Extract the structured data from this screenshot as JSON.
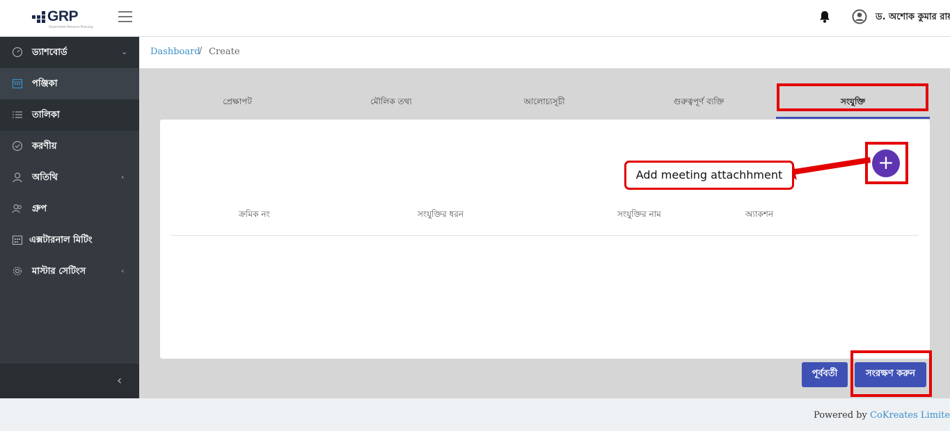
{
  "header": {
    "logo_text": "GRP",
    "logo_tagline": "Government Resource Planning",
    "username": "ড. অশোক কুমার রায়"
  },
  "sidebar": {
    "items": [
      {
        "label": "ড্যাশবোর্ড",
        "icon": "dashboard-gauge-icon",
        "chevron": "⌄"
      },
      {
        "label": "পঞ্জিকা",
        "icon": "calendar-icon"
      },
      {
        "label": "তালিকা",
        "icon": "list-icon"
      },
      {
        "label": "করণীয়",
        "icon": "check-circle-icon"
      },
      {
        "label": "অতিথি",
        "icon": "user-icon",
        "chevron": "‹"
      },
      {
        "label": "গ্রুপ",
        "icon": "group-icon"
      },
      {
        "label": "এক্সটারনাল মিটিং",
        "icon": "calendar-grid-icon"
      },
      {
        "label": "মাস্টার সেটিংস",
        "icon": "gear-icon",
        "chevron": "‹"
      }
    ],
    "collapse_glyph": "‹"
  },
  "breadcrumb": {
    "root": "Dashboard",
    "separator": "/",
    "current": "Create"
  },
  "tabs": [
    {
      "label": "প্রেক্ষাপট"
    },
    {
      "label": "মৌলিক তথ্য"
    },
    {
      "label": "আলোচ্যসূচী"
    },
    {
      "label": "গুরুত্বপূর্ণ ব্যক্তি"
    },
    {
      "label": "সংযুক্তি",
      "active": true
    }
  ],
  "table": {
    "headers": [
      "ক্রমিক নং",
      "সংযুক্তির ধরন",
      "সংযুক্তির নাম",
      "অ্যাকশন"
    ],
    "rows": []
  },
  "add_button": {
    "glyph": "+"
  },
  "callout": {
    "text": "Add meeting attachhment"
  },
  "buttons": {
    "previous": "পূর্ববর্তী",
    "save": "সংরক্ষণ করুন"
  },
  "footer": {
    "prefix": "Powered by",
    "link": "CoKreates Limited"
  },
  "colors": {
    "primary": "#3f51b5",
    "add_button": "#5e35b1",
    "highlight": "#e30000",
    "link": "#3a8fc9",
    "sidebar": "#343a40"
  }
}
